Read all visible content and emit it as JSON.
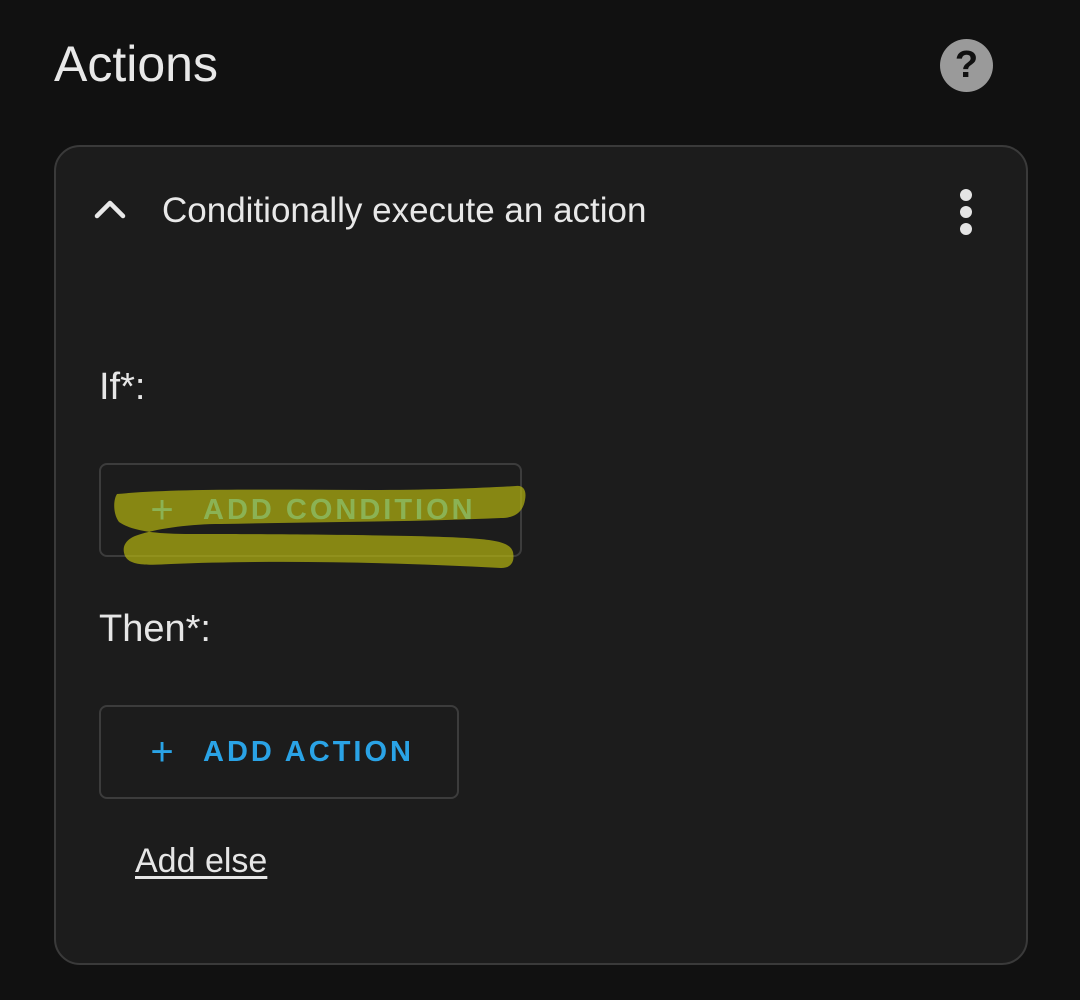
{
  "header": {
    "title": "Actions",
    "help_icon": "help-circle-icon",
    "help_glyph": "?"
  },
  "card": {
    "title": "Conditionally execute an action",
    "collapse_icon": "chevron-up-icon",
    "menu_icon": "more-vertical-icon",
    "if_section": {
      "label": "If*:",
      "button_label": "ADD CONDITION",
      "button_icon": "plus-icon",
      "button_glyph": "+"
    },
    "then_section": {
      "label": "Then*:",
      "button_label": "ADD ACTION",
      "button_icon": "plus-icon",
      "button_glyph": "+"
    },
    "add_else_label": "Add else"
  },
  "colors": {
    "background": "#111111",
    "card_background": "#1c1c1c",
    "card_border": "#3a3a3a",
    "accent": "#2aa3e6",
    "highlight_marker": "#8a8a10"
  }
}
